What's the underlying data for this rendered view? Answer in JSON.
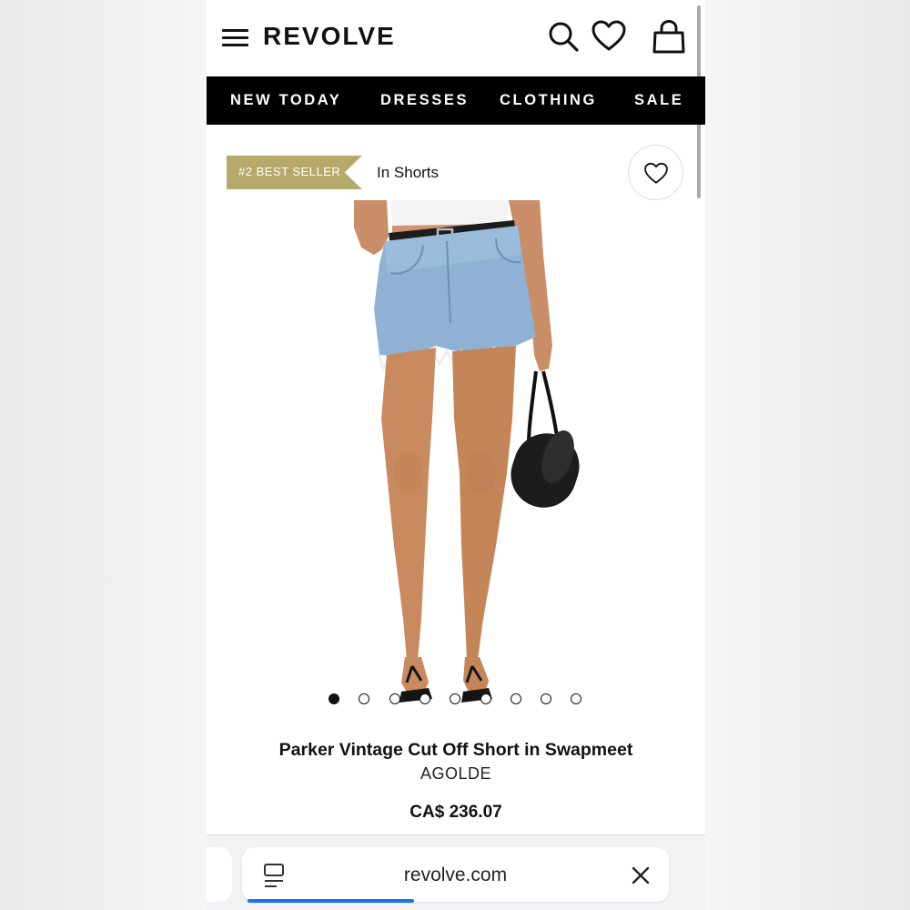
{
  "header": {
    "logo": "REVOLVE",
    "icons": [
      "menu-icon",
      "search-icon",
      "heart-icon",
      "shopping-bag-icon"
    ]
  },
  "nav": {
    "items": [
      {
        "label": "NEW TODAY"
      },
      {
        "label": "DRESSES"
      },
      {
        "label": "CLOTHING"
      },
      {
        "label": "SALE"
      }
    ]
  },
  "product": {
    "badge": "#2 BEST SELLER",
    "category_link": "In Shorts",
    "title": "Parker Vintage Cut Off Short in Swapmeet",
    "brand": "AGOLDE",
    "price": "CA$ 236.07",
    "image_dots": {
      "count": 9,
      "active_index": 0
    }
  },
  "browser": {
    "url": "revolve.com",
    "load_progress": 0.39
  },
  "colors": {
    "badge": "#b5aa6c",
    "nav_bg": "#000000",
    "progress": "#1a73e8"
  }
}
